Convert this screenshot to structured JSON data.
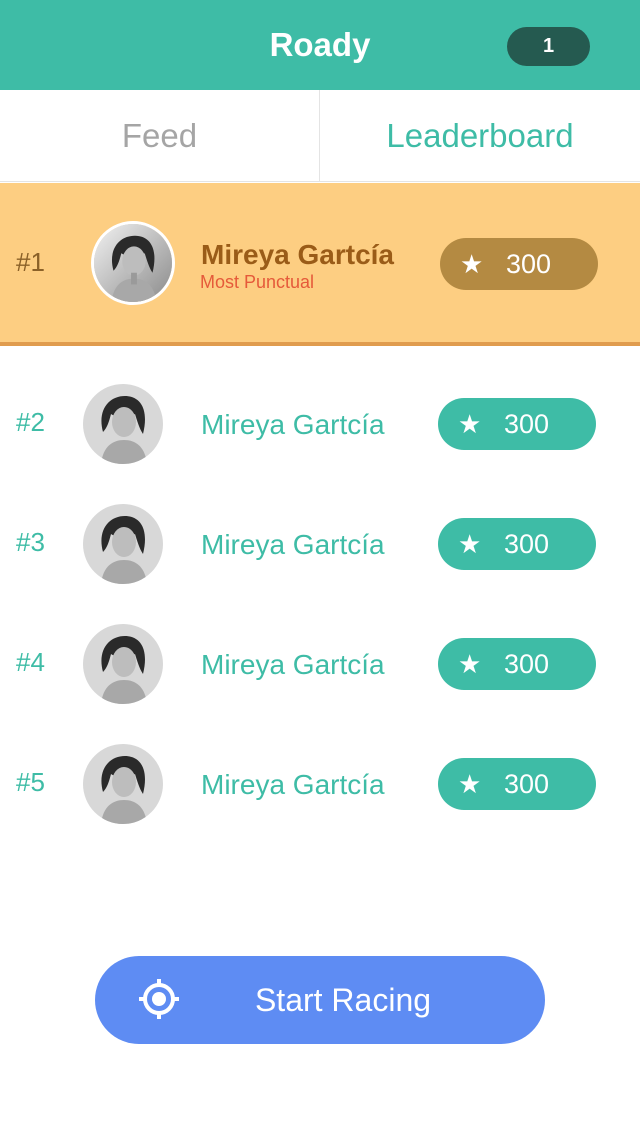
{
  "header": {
    "title": "Roady",
    "notification_count": "1"
  },
  "tabs": [
    {
      "label": "Feed",
      "active": false
    },
    {
      "label": "Leaderboard",
      "active": true
    }
  ],
  "leaderboard": [
    {
      "rank": "#1",
      "name": "Mireya Gartcía",
      "subtitle": "Most Punctual",
      "points": "300"
    },
    {
      "rank": "#2",
      "name": "Mireya Gartcía",
      "points": "300"
    },
    {
      "rank": "#3",
      "name": "Mireya Gartcía",
      "points": "300"
    },
    {
      "rank": "#4",
      "name": "Mireya Gartcía",
      "points": "300"
    },
    {
      "rank": "#5",
      "name": "Mireya Gartcía",
      "points": "300"
    }
  ],
  "cta": {
    "label": "Start Racing",
    "icon": "target-icon"
  },
  "colors": {
    "primary": "#3ebca6",
    "highlight": "#fdce82",
    "cta": "#5e8cf3",
    "badge": "#255a50"
  }
}
